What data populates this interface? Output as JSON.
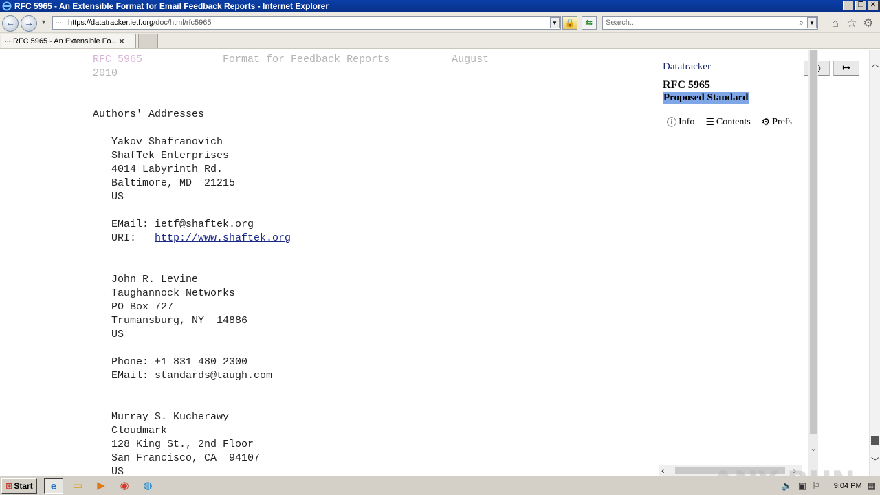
{
  "window": {
    "title": "RFC 5965 - An Extensible Format for Email Feedback Reports - Internet Explorer",
    "minimize": "_",
    "restore": "❐",
    "close": "✕"
  },
  "nav": {
    "url_prefix": "https://",
    "url_host": "datatracker.ietf.org",
    "url_path": "/doc/html/rfc5965",
    "search_placeholder": "Search..."
  },
  "tabs": [
    {
      "label": "RFC 5965 - An Extensible Fo..."
    }
  ],
  "header_line": {
    "rfc_link": "RFC 5965",
    "middle": "             Format for Feedback Reports          August",
    "year": "2010"
  },
  "doc": {
    "section_title": "Authors' Addresses",
    "author1": {
      "name": "Yakov Shafranovich",
      "org": "ShafTek Enterprises",
      "street": "4014 Labyrinth Rd.",
      "city": "Baltimore, MD  21215",
      "country": "US",
      "email_label": "EMail: ",
      "email": "ietf@shaftek.org",
      "uri_label": "URI:   ",
      "uri": "http://www.shaftek.org"
    },
    "author2": {
      "name": "John R. Levine",
      "org": "Taughannock Networks",
      "street": "PO Box 727",
      "city": "Trumansburg, NY  14886",
      "country": "US",
      "phone_label": "Phone: ",
      "phone": "+1 831 480 2300",
      "email_label": "EMail: ",
      "email": "standards@taugh.com"
    },
    "author3": {
      "name": "Murray S. Kucherawy",
      "org": "Cloudmark",
      "street": "128 King St., 2nd Floor",
      "city": "San Francisco, CA  94107",
      "country": "US"
    }
  },
  "sidebar": {
    "datatracker": "Datatracker",
    "rfc_number": "RFC 5965",
    "status": "Proposed Standard",
    "menu": [
      {
        "glyph": "ⓘ",
        "label": "Info"
      },
      {
        "glyph": "☰",
        "label": "Contents"
      },
      {
        "glyph": "⚙",
        "label": "Prefs"
      }
    ]
  },
  "watermark": "ANY RUN",
  "taskbar": {
    "start": "Start",
    "clock": "9:04 PM"
  }
}
